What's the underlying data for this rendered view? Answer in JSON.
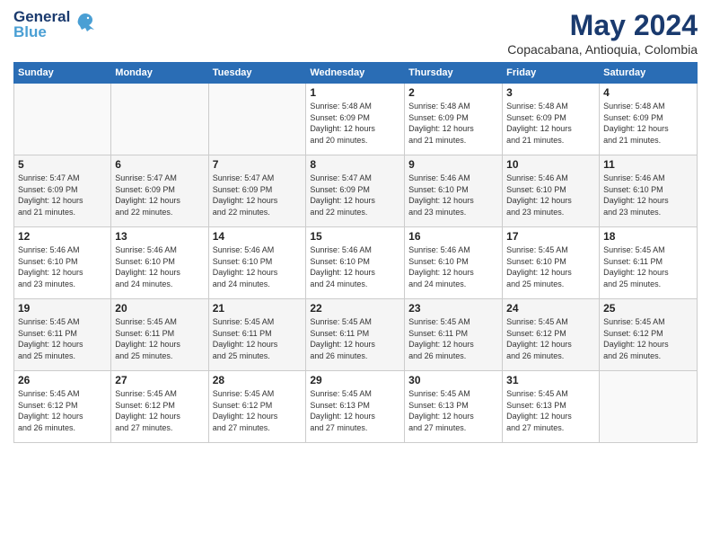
{
  "logo": {
    "line1": "General",
    "line2": "Blue"
  },
  "title": "May 2024",
  "location": "Copacabana, Antioquia, Colombia",
  "weekdays": [
    "Sunday",
    "Monday",
    "Tuesday",
    "Wednesday",
    "Thursday",
    "Friday",
    "Saturday"
  ],
  "weeks": [
    [
      {
        "day": "",
        "info": ""
      },
      {
        "day": "",
        "info": ""
      },
      {
        "day": "",
        "info": ""
      },
      {
        "day": "1",
        "info": "Sunrise: 5:48 AM\nSunset: 6:09 PM\nDaylight: 12 hours\nand 20 minutes."
      },
      {
        "day": "2",
        "info": "Sunrise: 5:48 AM\nSunset: 6:09 PM\nDaylight: 12 hours\nand 21 minutes."
      },
      {
        "day": "3",
        "info": "Sunrise: 5:48 AM\nSunset: 6:09 PM\nDaylight: 12 hours\nand 21 minutes."
      },
      {
        "day": "4",
        "info": "Sunrise: 5:48 AM\nSunset: 6:09 PM\nDaylight: 12 hours\nand 21 minutes."
      }
    ],
    [
      {
        "day": "5",
        "info": "Sunrise: 5:47 AM\nSunset: 6:09 PM\nDaylight: 12 hours\nand 21 minutes."
      },
      {
        "day": "6",
        "info": "Sunrise: 5:47 AM\nSunset: 6:09 PM\nDaylight: 12 hours\nand 22 minutes."
      },
      {
        "day": "7",
        "info": "Sunrise: 5:47 AM\nSunset: 6:09 PM\nDaylight: 12 hours\nand 22 minutes."
      },
      {
        "day": "8",
        "info": "Sunrise: 5:47 AM\nSunset: 6:09 PM\nDaylight: 12 hours\nand 22 minutes."
      },
      {
        "day": "9",
        "info": "Sunrise: 5:46 AM\nSunset: 6:10 PM\nDaylight: 12 hours\nand 23 minutes."
      },
      {
        "day": "10",
        "info": "Sunrise: 5:46 AM\nSunset: 6:10 PM\nDaylight: 12 hours\nand 23 minutes."
      },
      {
        "day": "11",
        "info": "Sunrise: 5:46 AM\nSunset: 6:10 PM\nDaylight: 12 hours\nand 23 minutes."
      }
    ],
    [
      {
        "day": "12",
        "info": "Sunrise: 5:46 AM\nSunset: 6:10 PM\nDaylight: 12 hours\nand 23 minutes."
      },
      {
        "day": "13",
        "info": "Sunrise: 5:46 AM\nSunset: 6:10 PM\nDaylight: 12 hours\nand 24 minutes."
      },
      {
        "day": "14",
        "info": "Sunrise: 5:46 AM\nSunset: 6:10 PM\nDaylight: 12 hours\nand 24 minutes."
      },
      {
        "day": "15",
        "info": "Sunrise: 5:46 AM\nSunset: 6:10 PM\nDaylight: 12 hours\nand 24 minutes."
      },
      {
        "day": "16",
        "info": "Sunrise: 5:46 AM\nSunset: 6:10 PM\nDaylight: 12 hours\nand 24 minutes."
      },
      {
        "day": "17",
        "info": "Sunrise: 5:45 AM\nSunset: 6:10 PM\nDaylight: 12 hours\nand 25 minutes."
      },
      {
        "day": "18",
        "info": "Sunrise: 5:45 AM\nSunset: 6:11 PM\nDaylight: 12 hours\nand 25 minutes."
      }
    ],
    [
      {
        "day": "19",
        "info": "Sunrise: 5:45 AM\nSunset: 6:11 PM\nDaylight: 12 hours\nand 25 minutes."
      },
      {
        "day": "20",
        "info": "Sunrise: 5:45 AM\nSunset: 6:11 PM\nDaylight: 12 hours\nand 25 minutes."
      },
      {
        "day": "21",
        "info": "Sunrise: 5:45 AM\nSunset: 6:11 PM\nDaylight: 12 hours\nand 25 minutes."
      },
      {
        "day": "22",
        "info": "Sunrise: 5:45 AM\nSunset: 6:11 PM\nDaylight: 12 hours\nand 26 minutes."
      },
      {
        "day": "23",
        "info": "Sunrise: 5:45 AM\nSunset: 6:11 PM\nDaylight: 12 hours\nand 26 minutes."
      },
      {
        "day": "24",
        "info": "Sunrise: 5:45 AM\nSunset: 6:12 PM\nDaylight: 12 hours\nand 26 minutes."
      },
      {
        "day": "25",
        "info": "Sunrise: 5:45 AM\nSunset: 6:12 PM\nDaylight: 12 hours\nand 26 minutes."
      }
    ],
    [
      {
        "day": "26",
        "info": "Sunrise: 5:45 AM\nSunset: 6:12 PM\nDaylight: 12 hours\nand 26 minutes."
      },
      {
        "day": "27",
        "info": "Sunrise: 5:45 AM\nSunset: 6:12 PM\nDaylight: 12 hours\nand 27 minutes."
      },
      {
        "day": "28",
        "info": "Sunrise: 5:45 AM\nSunset: 6:12 PM\nDaylight: 12 hours\nand 27 minutes."
      },
      {
        "day": "29",
        "info": "Sunrise: 5:45 AM\nSunset: 6:13 PM\nDaylight: 12 hours\nand 27 minutes."
      },
      {
        "day": "30",
        "info": "Sunrise: 5:45 AM\nSunset: 6:13 PM\nDaylight: 12 hours\nand 27 minutes."
      },
      {
        "day": "31",
        "info": "Sunrise: 5:45 AM\nSunset: 6:13 PM\nDaylight: 12 hours\nand 27 minutes."
      },
      {
        "day": "",
        "info": ""
      }
    ]
  ]
}
